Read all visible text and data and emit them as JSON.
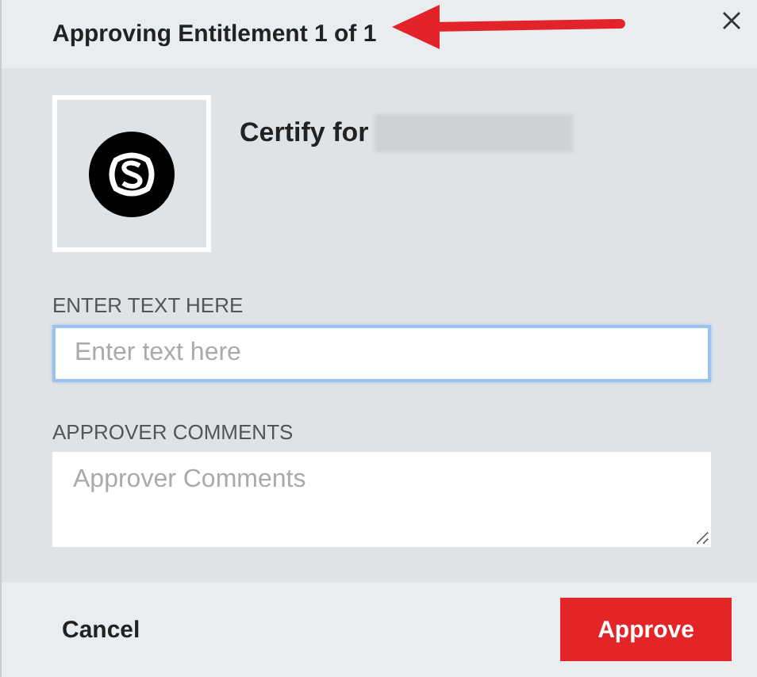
{
  "dialog": {
    "title": "Approving Entitlement 1 of 1"
  },
  "entitlement": {
    "heading": "Certify for"
  },
  "fields": [
    {
      "kind": "input",
      "label": "ENTER TEXT HERE",
      "placeholder": "Enter text here",
      "focused": true
    },
    {
      "kind": "textarea",
      "label": "APPROVER COMMENTS",
      "placeholder": "Approver Comments",
      "focused": false
    }
  ],
  "buttons": [
    {
      "kind": "plain",
      "label": "Cancel"
    },
    {
      "kind": "primary",
      "label": "Approve"
    }
  ]
}
